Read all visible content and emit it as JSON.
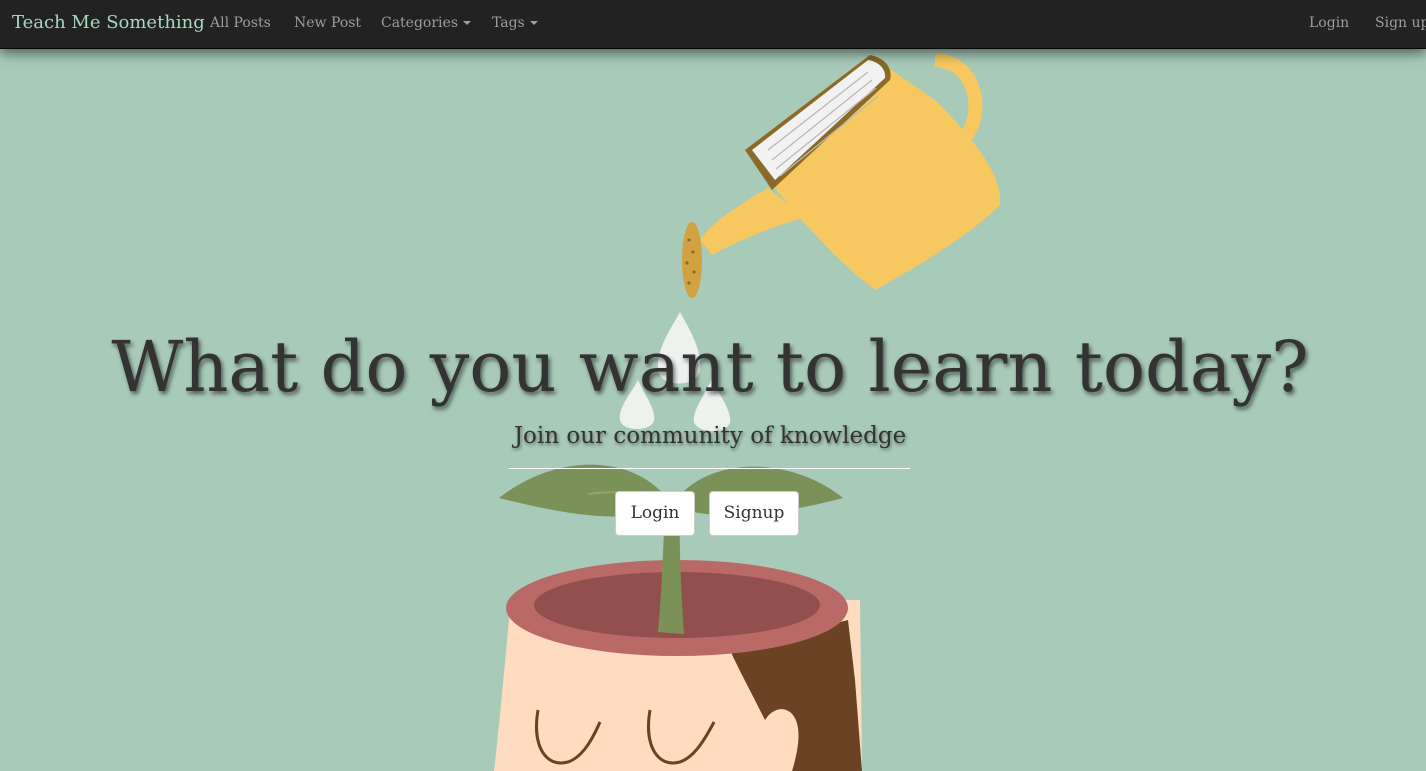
{
  "navbar": {
    "brand": "Teach Me Something",
    "links": {
      "all_posts": "All Posts",
      "new_post": "New Post",
      "categories": "Categories",
      "tags": "Tags"
    },
    "auth": {
      "login": "Login",
      "signup": "Sign up"
    }
  },
  "hero": {
    "headline": "What do you want to learn today?",
    "tagline": "Join our community of knowledge",
    "buttons": {
      "login": "Login",
      "signup": "Signup"
    },
    "illustration": {
      "icons": [
        "watering-can-icon",
        "book-icon",
        "water-drop-icon",
        "sprout-icon",
        "flower-pot-icon",
        "head-icon"
      ]
    }
  },
  "colors": {
    "navbar_bg": "#222222",
    "brand": "#a8d8bf",
    "nav_link": "#9d9d9d",
    "background": "#a8cab9",
    "watering_can": "#f6c85f",
    "pot_rim": "#b96a66",
    "leaf": "#7a9258",
    "skin": "#ffdcc0",
    "hair": "#6b4324",
    "headline_text": "#333333"
  }
}
